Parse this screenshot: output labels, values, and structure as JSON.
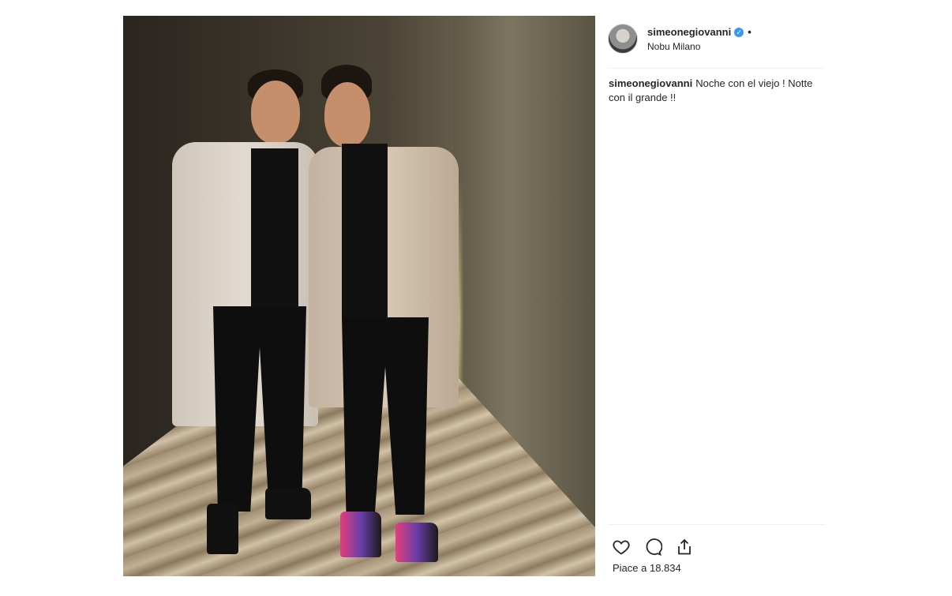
{
  "post": {
    "photo_alt": "Two men in long beige coats standing in a hallway",
    "username": "simeonegiovanni",
    "verified_mark": "✓",
    "dot": "•",
    "location": "Nobu Milano",
    "caption_user": "simeonegiovanni",
    "caption_text": "Noche con el viejo ! Notte con il grande !!",
    "likes_label": "Piace a 18.834"
  },
  "icons": {
    "like": "heart-icon",
    "comment": "comment-icon",
    "share": "share-icon"
  },
  "colors": {
    "text": "#262626",
    "verified": "#3897f0",
    "divider": "#efefef"
  }
}
